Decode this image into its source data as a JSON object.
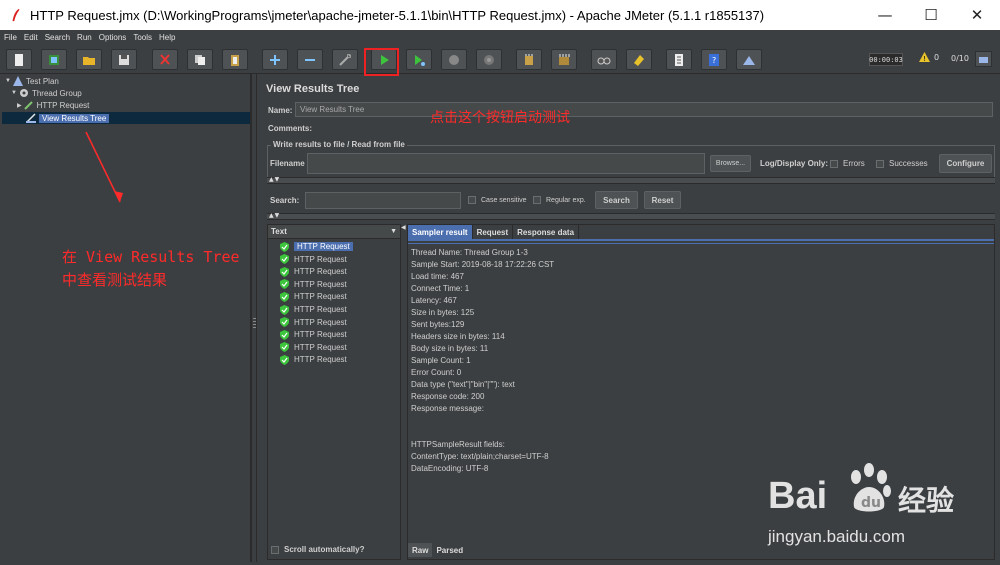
{
  "window": {
    "title": "HTTP Request.jmx (D:\\WorkingPrograms\\jmeter\\apache-jmeter-5.1.1\\bin\\HTTP Request.jmx) - Apache JMeter (5.1.1 r1855137)",
    "minimize": "—",
    "maximize": "☐",
    "close": "✕"
  },
  "menu": [
    "File",
    "Edit",
    "Search",
    "Run",
    "Options",
    "Tools",
    "Help"
  ],
  "toolbar": {
    "timer": "00:00:03",
    "warnings": "0",
    "threads": "0/10"
  },
  "tree": {
    "test_plan": "Test Plan",
    "thread_group": "Thread Group",
    "http_request": "HTTP Request",
    "view_results_tree": "View Results Tree"
  },
  "panel": {
    "title": "View Results Tree",
    "name_label": "Name:",
    "name_value": "View Results Tree",
    "comments_label": "Comments:",
    "write_results_title": "Write results to file / Read from file",
    "filename_label": "Filename",
    "browse": "Browse...",
    "log_display_only": "Log/Display Only:",
    "errors": "Errors",
    "successes": "Successes",
    "configure": "Configure",
    "search_label": "Search:",
    "case_sensitive": "Case sensitive",
    "regular_exp": "Regular exp.",
    "search_button": "Search",
    "reset_button": "Reset"
  },
  "results": {
    "header": "Text",
    "items": [
      "HTTP Request",
      "HTTP Request",
      "HTTP Request",
      "HTTP Request",
      "HTTP Request",
      "HTTP Request",
      "HTTP Request",
      "HTTP Request",
      "HTTP Request",
      "HTTP Request"
    ],
    "scroll_auto": "Scroll automatically?"
  },
  "detail": {
    "tabs": [
      "Sampler result",
      "Request",
      "Response data"
    ],
    "lines": [
      "Thread Name: Thread Group 1-3",
      "Sample Start: 2019-08-18 17:22:26 CST",
      "Load time: 467",
      "Connect Time: 1",
      "Latency: 467",
      "Size in bytes: 125",
      "Sent bytes:129",
      "Headers size in bytes: 114",
      "Body size in bytes: 11",
      "Sample Count: 1",
      "Error Count: 0",
      "Data type (\"text\"|\"bin\"|\"\"): text",
      "Response code: 200",
      "Response message: ",
      "",
      "",
      "HTTPSampleResult fields:",
      "ContentType: text/plain;charset=UTF-8",
      "DataEncoding: UTF-8"
    ],
    "bottom_tabs": [
      "Raw",
      "Parsed"
    ]
  },
  "annotations": {
    "click_button": "点击这个按钮启动测试",
    "view_results_1": "在 View Results Tree",
    "view_results_2": "中查看测试结果"
  },
  "watermark": {
    "brand": "Bai",
    "brand2": "经验",
    "url": "jingyan.baidu.com"
  },
  "colors": {
    "accent": "#4b6eaf",
    "annotation": "#ff2a2a",
    "success": "#3cc43c"
  }
}
